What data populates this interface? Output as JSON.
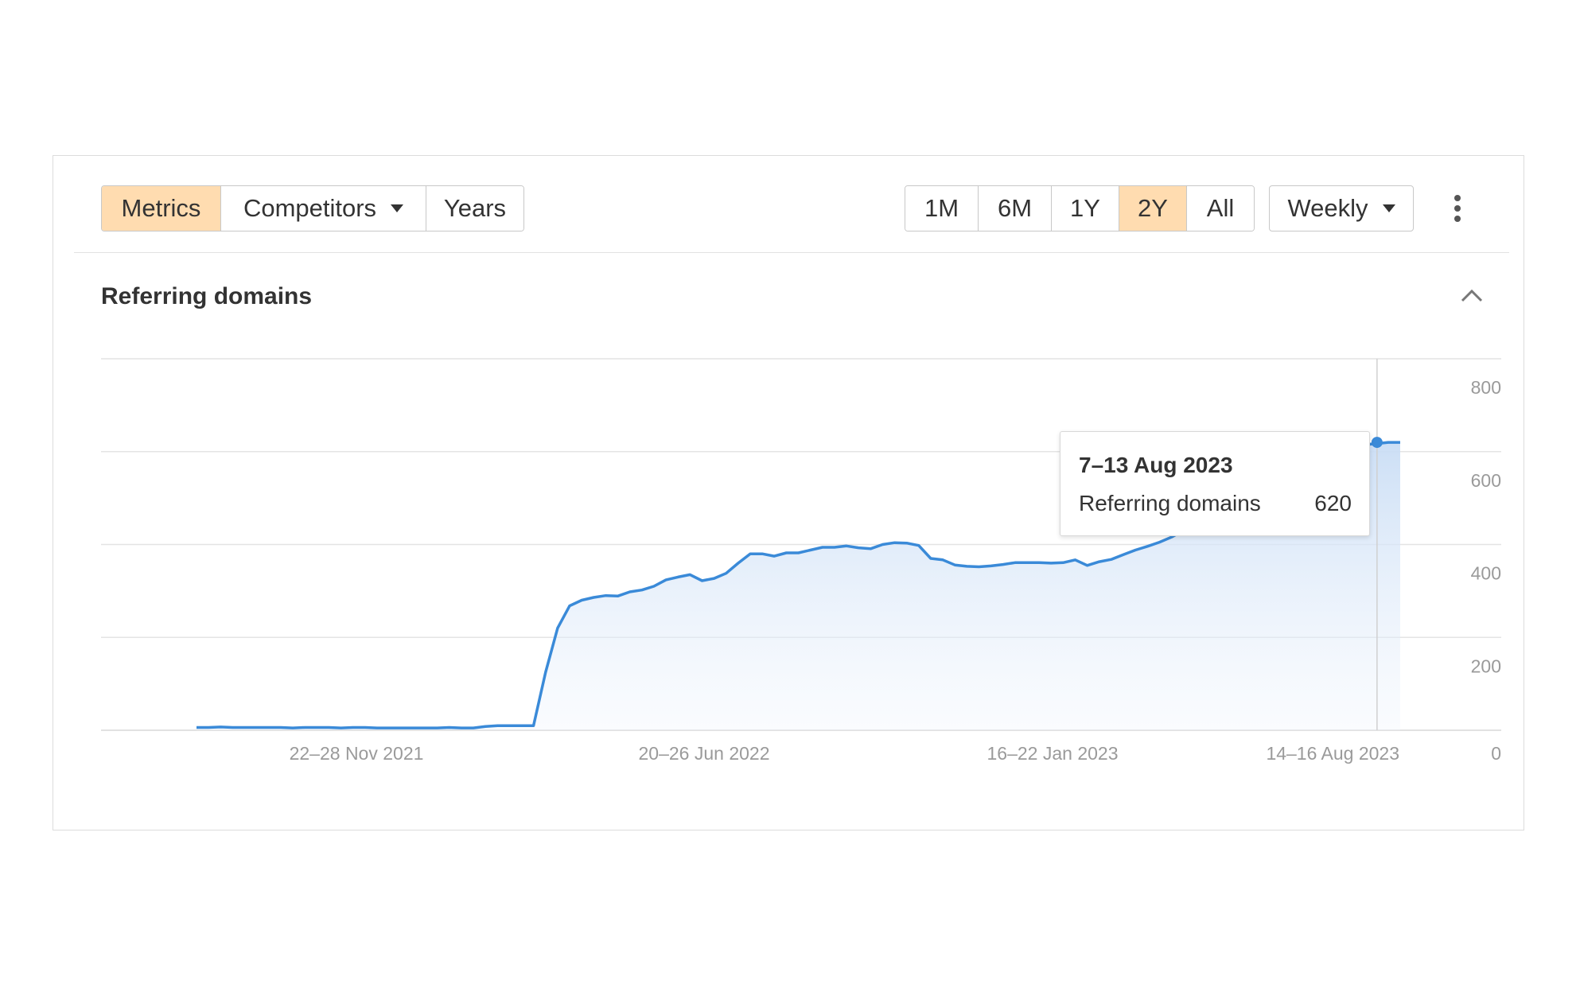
{
  "toolbar": {
    "view_tabs": [
      {
        "label": "Metrics",
        "active": true
      },
      {
        "label": "Competitors",
        "active": false,
        "dropdown": true
      },
      {
        "label": "Years",
        "active": false
      }
    ],
    "range_tabs": [
      {
        "label": "1M",
        "active": false
      },
      {
        "label": "6M",
        "active": false
      },
      {
        "label": "1Y",
        "active": false
      },
      {
        "label": "2Y",
        "active": true
      },
      {
        "label": "All",
        "active": false
      }
    ],
    "interval": "Weekly",
    "more_icon": "kebab-menu-icon",
    "active_color": "#ffdcb0"
  },
  "section": {
    "title": "Referring domains",
    "collapse_icon": "chevron-up-icon"
  },
  "tooltip": {
    "date": "7–13 Aug 2023",
    "label": "Referring domains",
    "value": "620"
  },
  "chart_data": {
    "type": "area",
    "series": [
      {
        "values": [
          6,
          6,
          7,
          6,
          6,
          6,
          6,
          6,
          5,
          6,
          6,
          6,
          5,
          6,
          6,
          5,
          5,
          5,
          5,
          5,
          5,
          6,
          5,
          5,
          8,
          10,
          10,
          10,
          10,
          125,
          220,
          268,
          280,
          286,
          290,
          289,
          298,
          302,
          310,
          324,
          330,
          335,
          322,
          327,
          338,
          360,
          380,
          380,
          375,
          382,
          382,
          388,
          394,
          394,
          397,
          393,
          391,
          400,
          404,
          403,
          398,
          370,
          367,
          356,
          353,
          352,
          354,
          357,
          361,
          361,
          361,
          360,
          361,
          367,
          355,
          363,
          368,
          378,
          388,
          396,
          405,
          416,
          430,
          445,
          458,
          470,
          482,
          495,
          508,
          520,
          532,
          545,
          558,
          572,
          585,
          598,
          608,
          615,
          617,
          620,
          620
        ]
      }
    ],
    "x_ticks": [
      "22–28 Nov 2021",
      "20–26 Jun 2022",
      "16–22 Jan 2023",
      "14–16 Aug 2023"
    ],
    "y_ticks": [
      "800",
      "600",
      "400",
      "200",
      "0"
    ],
    "ylim": [
      0,
      800
    ],
    "grid": true,
    "highlight_index": 99,
    "line_color": "#3a8ad8",
    "fill_color": "#cfe1f6"
  }
}
